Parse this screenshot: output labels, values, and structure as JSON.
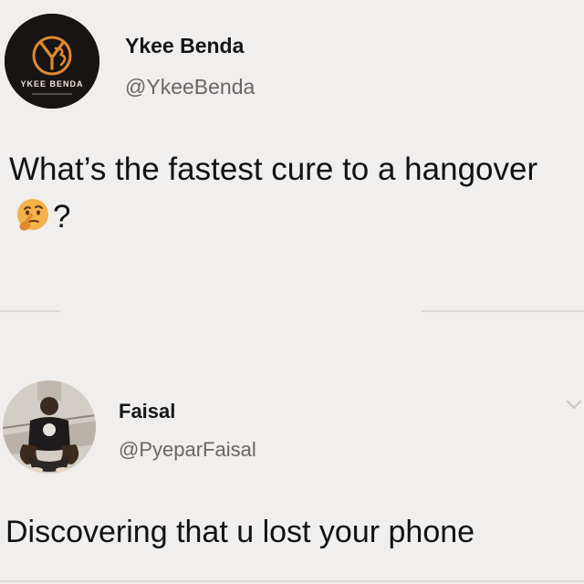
{
  "tweets": [
    {
      "author_name": "Ykee Benda",
      "author_handle": "@YkeeBenda",
      "avatar_text": "YKEE BENDA",
      "avatar_monogram": "YB",
      "text_before_emoji": "What’s the fastest cure to a hangover",
      "emoji": "thinking-face-icon",
      "text_after_emoji": "?"
    },
    {
      "author_name": "Faisal",
      "author_handle": "@PyeparFaisal",
      "text": "Discovering that u lost your phone"
    }
  ],
  "colors": {
    "background": "#f1eeee",
    "text": "#141414",
    "handle": "#6a6666",
    "divider": "#dcd8d8",
    "logo_orange": "#e08a2e"
  },
  "icons": [
    "thinking-face-icon",
    "chevron-down-icon"
  ]
}
